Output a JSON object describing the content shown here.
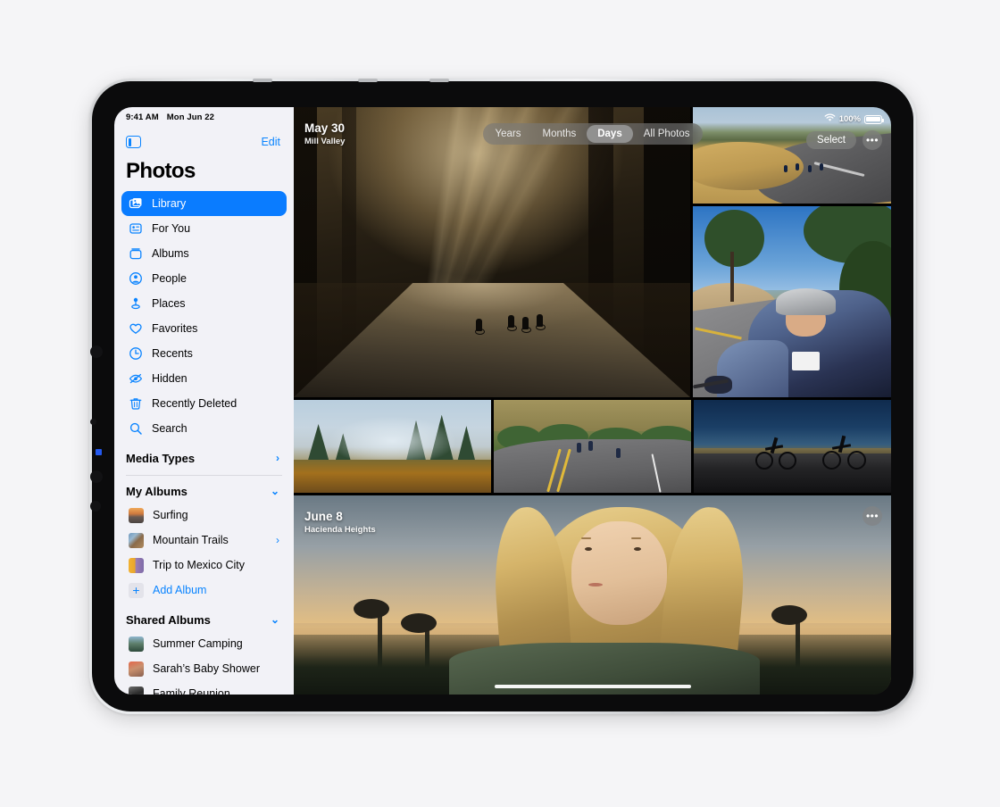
{
  "status_bar": {
    "time": "9:41 AM",
    "date": "Mon Jun 22"
  },
  "status_right": {
    "battery_percent": "100%",
    "wifi_icon": "wifi-icon",
    "battery_icon": "battery-icon"
  },
  "sidebar": {
    "toggle_icon": "sidebar-toggle-icon",
    "edit_label": "Edit",
    "title": "Photos",
    "nav_items": [
      {
        "label": "Library",
        "icon": "photo-stack-icon",
        "selected": true
      },
      {
        "label": "For You",
        "icon": "for-you-card-icon",
        "selected": false
      },
      {
        "label": "Albums",
        "icon": "albums-box-icon",
        "selected": false
      },
      {
        "label": "People",
        "icon": "person-circle-icon",
        "selected": false
      },
      {
        "label": "Places",
        "icon": "map-pin-icon",
        "selected": false
      },
      {
        "label": "Favorites",
        "icon": "heart-icon",
        "selected": false
      },
      {
        "label": "Recents",
        "icon": "clock-icon",
        "selected": false
      },
      {
        "label": "Hidden",
        "icon": "eye-slash-icon",
        "selected": false
      },
      {
        "label": "Recently Deleted",
        "icon": "trash-icon",
        "selected": false
      },
      {
        "label": "Search",
        "icon": "search-icon",
        "selected": false
      }
    ],
    "media_types": {
      "label": "Media Types",
      "chevron": "›"
    },
    "my_albums": {
      "label": "My Albums",
      "chevron": "⌄",
      "items": [
        {
          "label": "Surfing",
          "thumb": "tb-surf",
          "chevron": ""
        },
        {
          "label": "Mountain Trails",
          "thumb": "tb-mtn",
          "chevron": "›"
        },
        {
          "label": "Trip to Mexico City",
          "thumb": "tb-mex",
          "chevron": ""
        }
      ],
      "add_label": "Add Album",
      "add_icon": "plus-icon"
    },
    "shared_albums": {
      "label": "Shared Albums",
      "chevron": "⌄",
      "items": [
        {
          "label": "Summer Camping",
          "thumb": "tb-camp"
        },
        {
          "label": "Sarah’s Baby Shower",
          "thumb": "tb-baby"
        },
        {
          "label": "Family Reunion",
          "thumb": "tb-fam"
        }
      ]
    }
  },
  "main": {
    "segmented": {
      "options": [
        "Years",
        "Months",
        "Days",
        "All Photos"
      ],
      "selected": "Days"
    },
    "select_label": "Select",
    "more_icon": "ellipsis-icon",
    "groups": [
      {
        "date": "May 30",
        "place": "Mill Valley"
      },
      {
        "date": "June 8",
        "place": "Hacienda Heights"
      }
    ],
    "photos": [
      {
        "name": "photo-forest-sunbeams-cyclists"
      },
      {
        "name": "photo-winding-road-cyclists"
      },
      {
        "name": "photo-cyclist-portrait"
      },
      {
        "name": "photo-foggy-hillside"
      },
      {
        "name": "photo-country-road-cyclists"
      },
      {
        "name": "photo-cyclist-silhouettes"
      },
      {
        "name": "photo-woman-portrait-sunset"
      }
    ]
  }
}
